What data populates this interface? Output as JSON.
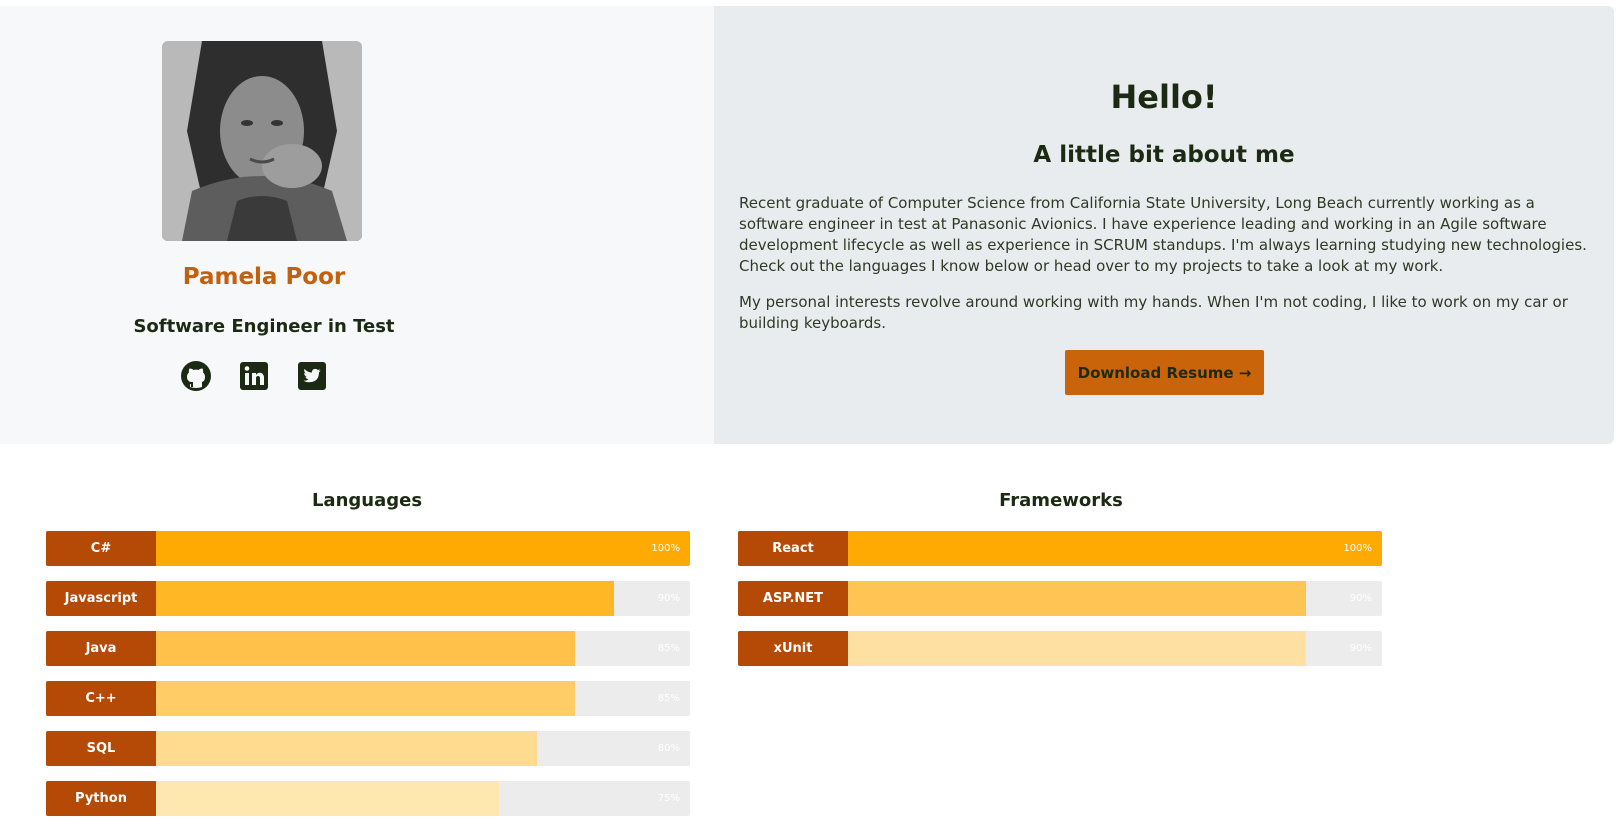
{
  "profile": {
    "name": "Pamela Poor",
    "role": "Software Engineer in Test",
    "socials": [
      "github-icon",
      "linkedin-icon",
      "twitter-icon"
    ]
  },
  "about": {
    "heading": "Hello!",
    "subheading": "A little bit about me",
    "paragraph1": "Recent graduate of Computer Science from California State University, Long Beach currently working as a software engineer in test at Panasonic Avionics. I have experience leading and working in an Agile software development lifecycle as well as experience in SCRUM standups. I'm always learning studying new technologies. Check out the languages I know below or head over to my projects to take a look at my work.",
    "paragraph2": "My personal interests revolve around working with my hands. When I'm not coding, I like to work on my car or building keyboards.",
    "button_label": "Download Resume →"
  },
  "colors": {
    "accent": "#c9640b",
    "label_bg": "#b54a06",
    "name": "#c2600d"
  },
  "languages": {
    "title": "Languages",
    "items": [
      {
        "label": "C#",
        "value": 100,
        "pct": "100%",
        "color": "#ffa903"
      },
      {
        "label": "Javascript",
        "value": 90,
        "pct": "90%",
        "color": "#ffb726"
      },
      {
        "label": "Java",
        "value": 85,
        "pct": "85%",
        "color": "#ffc14a"
      },
      {
        "label": "C++",
        "value": 85,
        "pct": "85%",
        "color": "#ffcc66"
      },
      {
        "label": "SQL",
        "value": 80,
        "pct": "80%",
        "color": "#ffdb8f"
      },
      {
        "label": "Python",
        "value": 75,
        "pct": "75%",
        "color": "#ffe7b0"
      }
    ]
  },
  "frameworks": {
    "title": "Frameworks",
    "items": [
      {
        "label": "React",
        "value": 100,
        "pct": "100%",
        "color": "#ffa903"
      },
      {
        "label": "ASP.NET",
        "value": 90,
        "pct": "90%",
        "color": "#ffc554"
      },
      {
        "label": "xUnit",
        "value": 90,
        "pct": "90%",
        "color": "#ffe0a3"
      }
    ]
  }
}
